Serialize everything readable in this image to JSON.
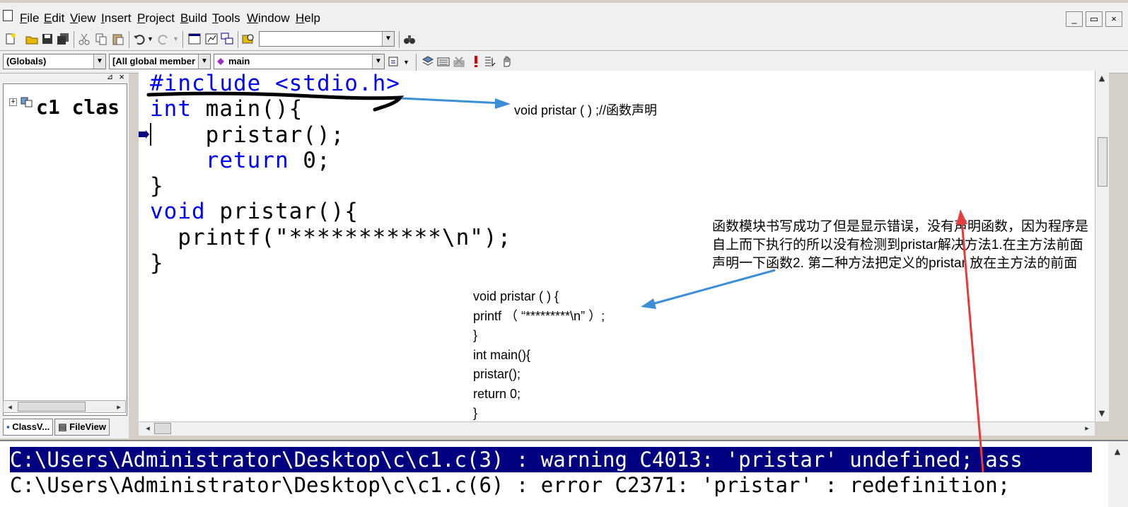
{
  "menubar": {
    "items": [
      {
        "label": "File",
        "accel": "F"
      },
      {
        "label": "Edit",
        "accel": "E"
      },
      {
        "label": "View",
        "accel": "V"
      },
      {
        "label": "Insert",
        "accel": "I"
      },
      {
        "label": "Project",
        "accel": "P"
      },
      {
        "label": "Build",
        "accel": "B"
      },
      {
        "label": "Tools",
        "accel": "T"
      },
      {
        "label": "Window",
        "accel": "W"
      },
      {
        "label": "Help",
        "accel": "H"
      }
    ],
    "window_buttons": [
      "_",
      "▭",
      "×"
    ]
  },
  "toolbar2": {
    "globals_combo": "(Globals)",
    "members_combo": "[All global member",
    "function_combo": "main"
  },
  "classview": {
    "tree_item": "c1 clas",
    "tabs": [
      "ClassV...",
      "FileView"
    ]
  },
  "editor": {
    "lines": [
      {
        "kw": "#include",
        "rest": " <stdio.h>"
      },
      {
        "kw": "int",
        "rest": " main(){"
      },
      {
        "kw": "",
        "rest": "    pristar();"
      },
      {
        "kw": "return",
        "rest": " 0;",
        "indent": "    "
      },
      {
        "kw": "",
        "rest": "}"
      },
      {
        "kw": "void",
        "rest": " pristar(){"
      },
      {
        "kw": "",
        "rest": "  printf(\"***********\\n\");"
      },
      {
        "kw": "",
        "rest": "}"
      }
    ]
  },
  "annotations": {
    "declaration_note": "void pristar ( ) ;//函数声明",
    "explanation": [
      "函数模块书写成功了但是显示错误，没有声明函数，因为程序是",
      "自上而下执行的所以没有检测到pristar解决方法1.在主方法前面",
      "声明一下函数2. 第二种方法把定义的pristar 放在主方法的前面"
    ],
    "fixed_code": [
      "void pristar ( ) {",
      "printf （  “*********\\n”  ）;",
      "}",
      "int main(){",
      "pristar();",
      "return 0;",
      "}"
    ],
    "arrow_color": "#3b8fd9",
    "red_arrow_color": "#e83a3a"
  },
  "output": {
    "lines": [
      "C:\\Users\\Administrator\\Desktop\\c\\c1.c(3) : warning C4013: 'pristar' undefined; ass",
      "C:\\Users\\Administrator\\Desktop\\c\\c1.c(6) : error C2371: 'pristar' : redefinition;"
    ]
  }
}
